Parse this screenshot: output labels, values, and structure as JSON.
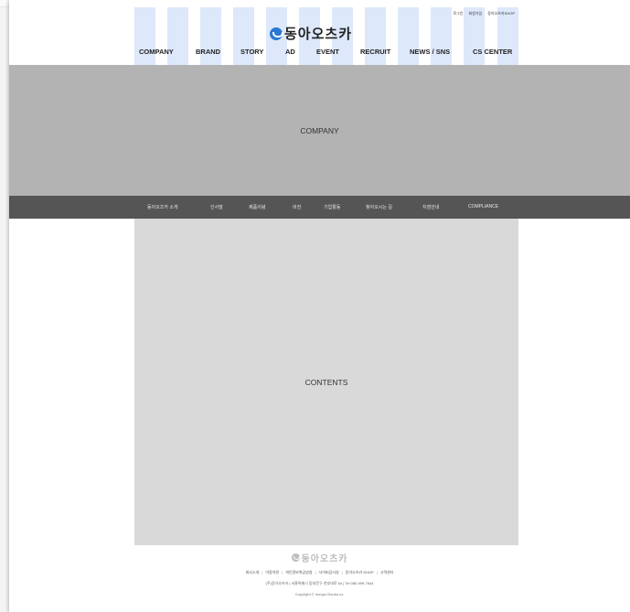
{
  "header": {
    "logo_text": "동아오츠카",
    "util_links": [
      "로그인",
      "회원가입",
      "동아오츠카SHOP"
    ],
    "nav": [
      "COMPANY",
      "BRAND",
      "STORY",
      "AD",
      "EVENT",
      "RECRUIT",
      "NEWS / SNS",
      "CS CENTER"
    ]
  },
  "hero": {
    "title": "COMPANY"
  },
  "subnav": {
    "items": [
      "동아오츠카 소개",
      "인사말",
      "제품이념",
      "비전",
      "기업활동",
      "찾아오시는 길",
      "지점안내",
      "COMPLIANCE"
    ]
  },
  "main": {
    "contents_label": "CONTENTS"
  },
  "footer": {
    "logo_text": "동아오츠카",
    "links": [
      "회사소개",
      "이용약관",
      "개인정보취급방침",
      "사이버감사실",
      "동아오츠카 SHOP",
      "고객센터"
    ],
    "info": "(주)동아오츠카  |  서울특별시 동대문구 천호대로 64  |  Tel 080-999-7644",
    "copyright": "Copyright © donga-Otsuka co."
  },
  "colors": {
    "guide": "#dde8fb",
    "hero": "#b3b3b3",
    "subnav": "#555555",
    "contents": "#d9d9d9",
    "logo_mark": "#2a78d4"
  }
}
